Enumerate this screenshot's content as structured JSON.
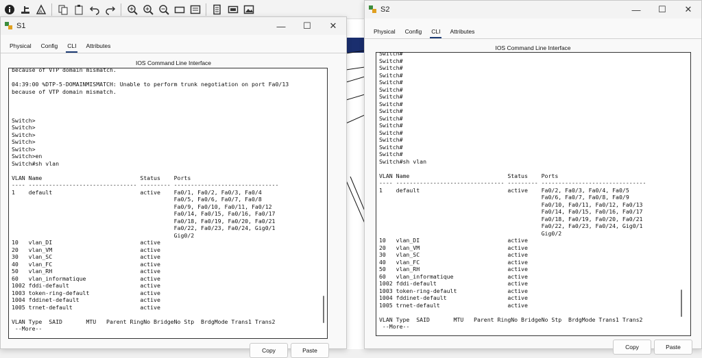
{
  "toolbar": {
    "icons": [
      "info-icon",
      "network-wizard-icon",
      "activity-wizard-icon",
      "copy-icon",
      "paste-icon",
      "undo-icon",
      "redo-icon",
      "zoom-in-icon",
      "zoom-reset-icon",
      "zoom-out-icon",
      "draw-rectangle-icon",
      "custom-device-icon",
      "list-icon",
      "palette-icon",
      "image-icon"
    ]
  },
  "s1": {
    "title": "S1",
    "tabs": [
      "Physical",
      "Config",
      "CLI",
      "Attributes"
    ],
    "active_tab": "CLI",
    "panel_title": "IOS Command Line Interface",
    "lines": [
      "because of VTP domain mismatch.",
      "",
      "04:39:00 %DTP-5-DOMAINMISMATCH: Unable to perform trunk negotiation on port Fa0/13",
      "because of VTP domain mismatch.",
      "",
      "",
      "",
      "Switch>",
      "Switch>",
      "Switch>",
      "Switch>",
      "Switch>",
      "Switch>en",
      "Switch#sh vlan",
      "",
      "VLAN Name                             Status    Ports",
      "---- -------------------------------- --------- -------------------------------",
      "1    default                          active    Fa0/1, Fa0/2, Fa0/3, Fa0/4",
      "                                                Fa0/5, Fa0/6, Fa0/7, Fa0/8",
      "                                                Fa0/9, Fa0/10, Fa0/11, Fa0/12",
      "                                                Fa0/14, Fa0/15, Fa0/16, Fa0/17",
      "                                                Fa0/18, Fa0/19, Fa0/20, Fa0/21",
      "                                                Fa0/22, Fa0/23, Fa0/24, Gig0/1",
      "                                                Gig0/2",
      "10   vlan_DI                          active",
      "20   vlan_VM                          active",
      "30   vlan_SC                          active",
      "40   vlan_FC                          active",
      "50   vlan_RH                          active",
      "60   vlan_informatique                active",
      "1002 fddi-default                     active",
      "1003 token-ring-default               active",
      "1004 fddinet-default                  active",
      "1005 trnet-default                    active",
      "",
      "VLAN Type  SAID       MTU   Parent RingNo BridgeNo Stp  BrdgMode Trans1 Trans2",
      " --More--"
    ],
    "copy_label": "Copy",
    "paste_label": "Paste"
  },
  "s2": {
    "title": "S2",
    "tabs": [
      "Physical",
      "Config",
      "CLI",
      "Attributes"
    ],
    "active_tab": "CLI",
    "panel_title": "IOS Command Line Interface",
    "lines": [
      "Switch#",
      "Switch#",
      "Switch#",
      "Switch#",
      "Switch#",
      "Switch#",
      "Switch#",
      "Switch#",
      "Switch#",
      "Switch#",
      "Switch#",
      "Switch#",
      "Switch#",
      "Switch#",
      "Switch#",
      "Switch#sh vlan",
      "",
      "VLAN Name                             Status    Ports",
      "---- -------------------------------- --------- -------------------------------",
      "1    default                          active    Fa0/2, Fa0/3, Fa0/4, Fa0/5",
      "                                                Fa0/6, Fa0/7, Fa0/8, Fa0/9",
      "                                                Fa0/10, Fa0/11, Fa0/12, Fa0/13",
      "                                                Fa0/14, Fa0/15, Fa0/16, Fa0/17",
      "                                                Fa0/18, Fa0/19, Fa0/20, Fa0/21",
      "                                                Fa0/22, Fa0/23, Fa0/24, Gig0/1",
      "                                                Gig0/2",
      "10   vlan_DI                          active",
      "20   vlan_VM                          active",
      "30   vlan_SC                          active",
      "40   vlan_FC                          active",
      "50   vlan_RH                          active",
      "60   vlan_informatique                active",
      "1002 fddi-default                     active",
      "1003 token-ring-default               active",
      "1004 fddinet-default                  active",
      "1005 trnet-default                    active",
      "",
      "VLAN Type  SAID       MTU   Parent RingNo BridgeNo Stp  BrdgMode Trans1 Trans2",
      " --More--"
    ],
    "copy_label": "Copy",
    "paste_label": "Paste"
  },
  "window_controls": {
    "minimize": "—",
    "maximize": "☐",
    "close": "✕"
  }
}
